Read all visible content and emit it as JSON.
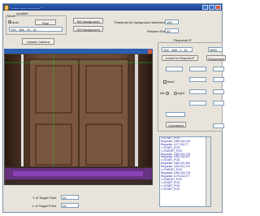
{
  "window": {
    "title": "...____ ___ ______ ... "
  },
  "updated": {
    "label": "updated"
  },
  "mode": {
    "group_label": "Mode",
    "option_a": "auto",
    "stop_label": "Stop"
  },
  "camera": {
    "ip_value": "192 . 168 . 20 . 11",
    "update_label": "Update Camera"
  },
  "background": {
    "set_label": "Set background",
    "get_label": "Get background",
    "threshold_label": "Threshold for background detection",
    "threshold_value": "100",
    "window_label": "Window Size",
    "window_value": "40"
  },
  "net": {
    "label": "Requests IP",
    "ip_value": "192 . 168 . 1 . 11",
    "port_value": "9800",
    "connect_label": "connect for Requests IP",
    "disconnect_label": "Disconnect"
  },
  "controls": {
    "fixed_label": "fixed",
    "left_label": "left",
    "right_label": "right",
    "command_label": "Command"
  },
  "targets": {
    "x_label": "Y of Target Point",
    "x_value": "20",
    "y_label": "L of Target Point",
    "y_value": "20"
  },
  "log": [
    "<<START_POS",
    "Requests: 1290,202,076",
    "Requests: 1177,210,77",
    "<<START_POS",
    "<<TARGET_POS",
    "Requests: 1200,210,176",
    "Requests: 1290,202,097",
    "<<START_POS",
    "Requests: 1180,210,180",
    "Requests: 1193,212,170",
    "<<TARGET_POS",
    "Requests: 1290,215,178",
    "Requests: 1179,212,077",
    "<<TARGET_POS",
    "<<START_POS",
    "<<START_POS",
    "<<START_POS"
  ]
}
